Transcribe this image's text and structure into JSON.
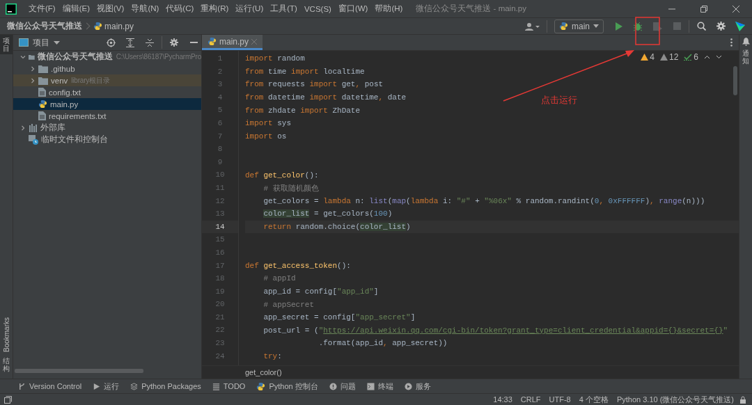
{
  "window": {
    "title": "微信公众号天气推送 - main.py"
  },
  "menu": [
    "文件(F)",
    "编辑(E)",
    "视图(V)",
    "导航(N)",
    "代码(C)",
    "重构(R)",
    "运行(U)",
    "工具(T)",
    "VCS(S)",
    "窗口(W)",
    "帮助(H)"
  ],
  "breadcrumbs": [
    "微信公众号天气推送",
    "main.py"
  ],
  "run_config": {
    "label": "main"
  },
  "left_stripe": {
    "top": "项目",
    "bookmarks": "Bookmarks",
    "structure": "结构"
  },
  "right_stripe": {
    "label": "通知"
  },
  "project_panel": {
    "title": "项目",
    "tree": [
      {
        "kind": "project",
        "label": "微信公众号天气推送",
        "hint": "C:\\Users\\86187\\PycharmPro",
        "expanded": true,
        "selected": false,
        "children": [
          {
            "kind": "folder",
            "label": ".github",
            "expanded": false,
            "selected": false
          },
          {
            "kind": "excluded",
            "label": "venv",
            "hint": "library根目录",
            "expanded": false,
            "selected": false
          },
          {
            "kind": "text",
            "label": "config.txt",
            "selected": false
          },
          {
            "kind": "python",
            "label": "main.py",
            "selected": true
          },
          {
            "kind": "text",
            "label": "requirements.txt",
            "selected": false
          }
        ]
      },
      {
        "kind": "library",
        "label": "外部库",
        "expanded": false,
        "selected": false
      },
      {
        "kind": "scratch",
        "label": "临时文件和控制台",
        "selected": false
      }
    ]
  },
  "editor": {
    "tabs": [
      {
        "label": "main.py",
        "selected": true
      }
    ],
    "inspections": {
      "warnings": "4",
      "weak_warnings": "12",
      "typos": "6"
    },
    "lines": [
      {
        "number": "1",
        "current": false,
        "tokens": [
          {
            "kind": "kw",
            "text": "import"
          },
          {
            "kind": "plain",
            "text": " random"
          }
        ]
      },
      {
        "number": "2",
        "current": false,
        "tokens": [
          {
            "kind": "kw",
            "text": "from"
          },
          {
            "kind": "plain",
            "text": " time "
          },
          {
            "kind": "kw",
            "text": "import"
          },
          {
            "kind": "plain",
            "text": " localtime"
          }
        ]
      },
      {
        "number": "3",
        "current": false,
        "tokens": [
          {
            "kind": "kw",
            "text": "from"
          },
          {
            "kind": "plain",
            "text": " requests "
          },
          {
            "kind": "kw",
            "text": "import"
          },
          {
            "kind": "plain",
            "text": " get"
          },
          {
            "kind": "kw",
            "text": ","
          },
          {
            "kind": "plain",
            "text": " post"
          }
        ]
      },
      {
        "number": "4",
        "current": false,
        "tokens": [
          {
            "kind": "kw",
            "text": "from"
          },
          {
            "kind": "plain",
            "text": " datetime "
          },
          {
            "kind": "kw",
            "text": "import"
          },
          {
            "kind": "plain",
            "text": " datetime"
          },
          {
            "kind": "kw",
            "text": ","
          },
          {
            "kind": "plain",
            "text": " date"
          }
        ]
      },
      {
        "number": "5",
        "current": false,
        "tokens": [
          {
            "kind": "kw",
            "text": "from"
          },
          {
            "kind": "plain",
            "text": " zhdate "
          },
          {
            "kind": "kw",
            "text": "import"
          },
          {
            "kind": "plain",
            "text": " ZhDate"
          }
        ]
      },
      {
        "number": "6",
        "current": false,
        "tokens": [
          {
            "kind": "kw",
            "text": "import"
          },
          {
            "kind": "plain",
            "text": " sys"
          }
        ]
      },
      {
        "number": "7",
        "current": false,
        "tokens": [
          {
            "kind": "kw",
            "text": "import"
          },
          {
            "kind": "plain",
            "text": " os"
          }
        ]
      },
      {
        "number": "8",
        "current": false
      },
      {
        "number": "9",
        "current": false
      },
      {
        "number": "10",
        "current": false,
        "tokens": [
          {
            "kind": "kw",
            "text": "def "
          },
          {
            "kind": "fn",
            "text": "get_color"
          },
          {
            "kind": "plain",
            "text": "():"
          }
        ]
      },
      {
        "number": "11",
        "current": false,
        "tokens": [
          {
            "kind": "cmt",
            "text": "    # 获取随机颜色"
          }
        ]
      },
      {
        "number": "12",
        "current": false,
        "tokens": [
          {
            "kind": "plain",
            "text": "    get_colors = "
          },
          {
            "kind": "kw",
            "text": "lambda"
          },
          {
            "kind": "plain",
            "text": " n: "
          },
          {
            "kind": "builtin",
            "text": "list"
          },
          {
            "kind": "plain",
            "text": "("
          },
          {
            "kind": "builtin",
            "text": "map"
          },
          {
            "kind": "plain",
            "text": "("
          },
          {
            "kind": "kw",
            "text": "lambda"
          },
          {
            "kind": "plain",
            "text": " i: "
          },
          {
            "kind": "str",
            "text": "\"#\""
          },
          {
            "kind": "plain",
            "text": " + "
          },
          {
            "kind": "str",
            "text": "\"%06x\""
          },
          {
            "kind": "plain",
            "text": " % random.randint("
          },
          {
            "kind": "num",
            "text": "0"
          },
          {
            "kind": "kw",
            "text": ", "
          },
          {
            "kind": "num",
            "text": "0xFFFFFF"
          },
          {
            "kind": "plain",
            "text": ")"
          },
          {
            "kind": "kw",
            "text": ", "
          },
          {
            "kind": "builtin",
            "text": "range"
          },
          {
            "kind": "plain",
            "text": "(n)))"
          }
        ]
      },
      {
        "number": "13",
        "current": false,
        "tokens": [
          {
            "kind": "hl",
            "text": "    color_list"
          },
          {
            "kind": "plain",
            "text": " = get_colors("
          },
          {
            "kind": "num",
            "text": "100"
          },
          {
            "kind": "plain",
            "text": ")"
          }
        ]
      },
      {
        "number": "14",
        "current": true,
        "tokens": [
          {
            "kind": "kw",
            "text": "    return"
          },
          {
            "kind": "plain",
            "text": " random.choice("
          },
          {
            "kind": "hl",
            "text": "color_list"
          },
          {
            "kind": "plain",
            "text": ")"
          }
        ]
      },
      {
        "number": "15",
        "current": false
      },
      {
        "number": "16",
        "current": false
      },
      {
        "number": "17",
        "current": false,
        "tokens": [
          {
            "kind": "kw",
            "text": "def "
          },
          {
            "kind": "fn",
            "text": "get_access_token"
          },
          {
            "kind": "plain",
            "text": "():"
          }
        ]
      },
      {
        "number": "18",
        "current": false,
        "tokens": [
          {
            "kind": "cmt",
            "text": "    # appId"
          }
        ]
      },
      {
        "number": "19",
        "current": false,
        "tokens": [
          {
            "kind": "plain",
            "text": "    app_id = config["
          },
          {
            "kind": "str",
            "text": "\"app_id\""
          },
          {
            "kind": "plain",
            "text": "]"
          }
        ]
      },
      {
        "number": "20",
        "current": false,
        "tokens": [
          {
            "kind": "cmt",
            "text": "    # appSecret"
          }
        ]
      },
      {
        "number": "21",
        "current": false,
        "tokens": [
          {
            "kind": "plain",
            "text": "    app_secret = config["
          },
          {
            "kind": "str",
            "text": "\"app_secret\""
          },
          {
            "kind": "plain",
            "text": "]"
          }
        ]
      },
      {
        "number": "22",
        "current": false,
        "tokens": [
          {
            "kind": "plain",
            "text": "    post_url = ("
          },
          {
            "kind": "str",
            "text": "\""
          },
          {
            "kind": "link",
            "text": "https://api.weixin.qq.com/cgi-bin/token?grant_type=client_credential&appid={}&secret={}"
          },
          {
            "kind": "str",
            "text": "\""
          }
        ]
      },
      {
        "number": "23",
        "current": false,
        "tokens": [
          {
            "kind": "plain",
            "text": "                .format(app_id"
          },
          {
            "kind": "kw",
            "text": ", "
          },
          {
            "kind": "plain",
            "text": "app_secret))"
          }
        ]
      },
      {
        "number": "24",
        "current": false,
        "tokens": [
          {
            "kind": "kw",
            "text": "    try"
          },
          {
            "kind": "plain",
            "text": ":"
          }
        ]
      }
    ],
    "breadcrumb": "get_color()"
  },
  "annotation": {
    "text": "点击运行"
  },
  "tool_tabs": [
    {
      "kind": "vcs",
      "label": "Version Control"
    },
    {
      "kind": "run",
      "label": "运行"
    },
    {
      "kind": "packages",
      "label": "Python Packages"
    },
    {
      "kind": "todo",
      "label": "TODO"
    },
    {
      "kind": "console",
      "label": "Python 控制台"
    },
    {
      "kind": "problems",
      "label": "问题"
    },
    {
      "kind": "terminal",
      "label": "终端"
    },
    {
      "kind": "services",
      "label": "服务"
    }
  ],
  "status_bar": [
    "14:33",
    "CRLF",
    "UTF-8",
    "4 个空格",
    "Python 3.10 (微信公众号天气推送)"
  ]
}
